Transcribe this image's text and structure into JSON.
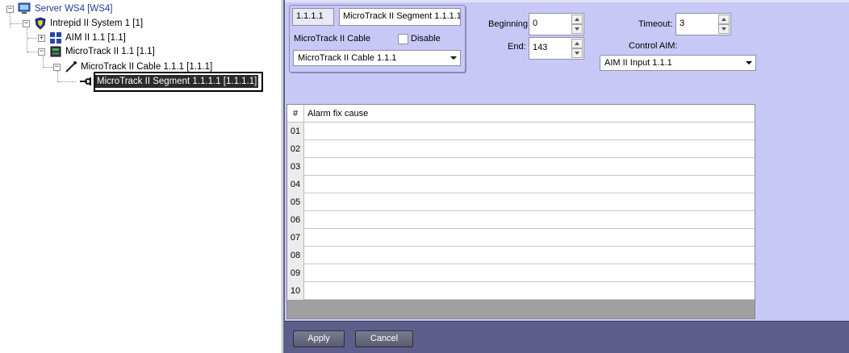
{
  "tree": {
    "items": [
      {
        "label": "Server WS4 [WS4]",
        "icon": "monitor-icon"
      },
      {
        "label": "Intrepid II System 1 [1]",
        "icon": "shield-icon"
      },
      {
        "label": "AIM II 1.1 [1.1]",
        "icon": "grid-module-icon"
      },
      {
        "label": "MicroTrack II 1.1 [1.1]",
        "icon": "controller-device-icon"
      },
      {
        "label": "MicroTrack II Cable 1.1.1 [1.1.1]",
        "icon": "cable-icon"
      },
      {
        "label": "MicroTrack II Segment 1.1.1.1 [1.1.1.1]",
        "icon": "segment-icon"
      }
    ]
  },
  "settings": {
    "id": "1.1.1.1",
    "name": "MicroTrack II Segment 1.1.1.1",
    "cable_label": "MicroTrack II Cable",
    "disable_label": "Disable",
    "cable_value": "MicroTrack II Cable 1.1.1",
    "beginning_label": "Beginning",
    "beginning_value": "0",
    "end_label": "End:",
    "end_value": "143",
    "timeout_label": "Timeout:",
    "timeout_value": "3",
    "control_aim_label": "Control AIM:",
    "control_aim_value": "AIM II Input 1.1.1"
  },
  "table": {
    "headers": [
      "#",
      "Alarm fix cause"
    ],
    "rows": [
      {
        "num": "01",
        "cause": ""
      },
      {
        "num": "02",
        "cause": ""
      },
      {
        "num": "03",
        "cause": ""
      },
      {
        "num": "04",
        "cause": ""
      },
      {
        "num": "05",
        "cause": ""
      },
      {
        "num": "06",
        "cause": ""
      },
      {
        "num": "07",
        "cause": ""
      },
      {
        "num": "08",
        "cause": ""
      },
      {
        "num": "09",
        "cause": ""
      },
      {
        "num": "10",
        "cause": ""
      }
    ]
  },
  "footer": {
    "apply_label": "Apply",
    "cancel_label": "Cancel"
  },
  "colors": {
    "panel_bg": "#c8c8f7",
    "footer_bg": "#5e5e8a",
    "tree_link": "#1a3d9a"
  }
}
